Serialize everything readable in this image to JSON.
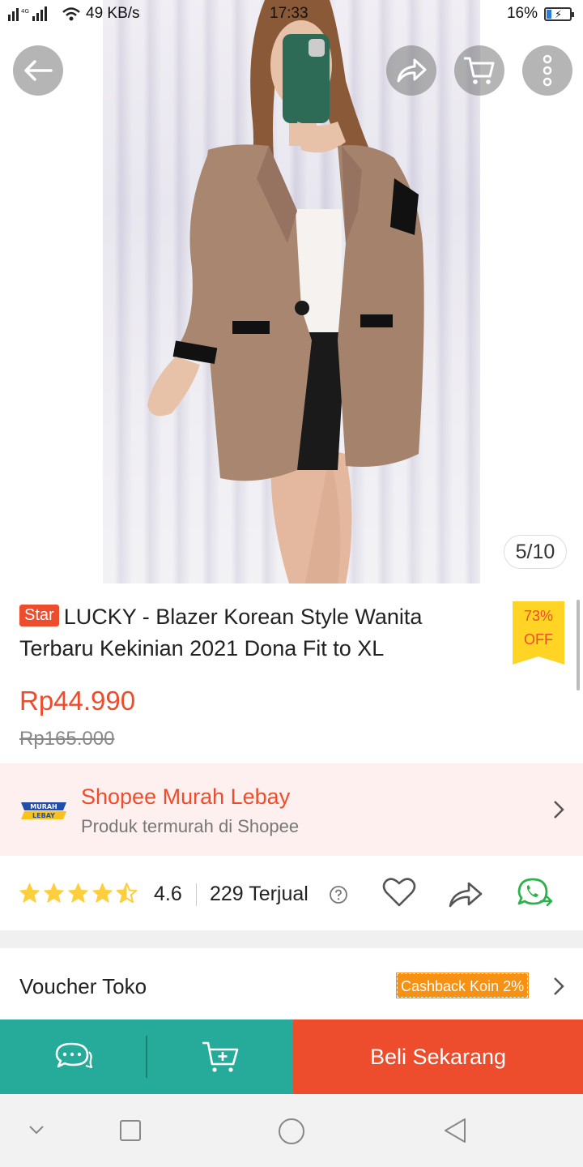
{
  "status_bar": {
    "network_speed": "49 KB/s",
    "time": "17:33",
    "battery": "16%",
    "network_type": "4G"
  },
  "gallery": {
    "counter": "5/10",
    "icons": [
      "back-arrow-icon",
      "share-icon",
      "cart-icon",
      "more-icon"
    ]
  },
  "product": {
    "badge": "Star",
    "title": "LUCKY -  Blazer Korean Style Wanita Terbaru Kekinian 2021 Dona Fit to XL",
    "discount_percent": "73%",
    "discount_off": "OFF",
    "price": "Rp44.990",
    "original_price": "Rp165.000"
  },
  "promo": {
    "logo_text_1": "MURAH",
    "logo_text_2": "LEBAY",
    "title": "Shopee Murah Lebay",
    "subtitle": "Produk termurah di Shopee"
  },
  "rating": {
    "value": "4.6",
    "stars": 4.6,
    "sold": "229 Terjual"
  },
  "voucher": {
    "label": "Voucher Toko",
    "cashback": "Cashback Koin 2%"
  },
  "bottom_bar": {
    "buy_label": "Beli Sekarang"
  },
  "colors": {
    "brand": "#ee4d2d",
    "teal": "#26aa99",
    "discount_bg": "#ffd424",
    "cashback_bg": "#f69113",
    "star": "#ffce3d"
  }
}
